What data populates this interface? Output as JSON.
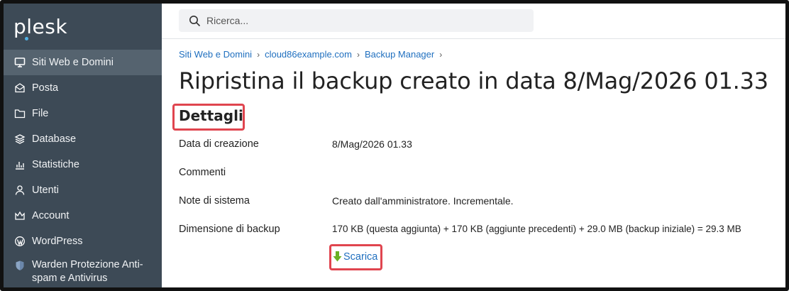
{
  "app": {
    "logo": "plesk"
  },
  "sidebar": {
    "items": [
      {
        "label": "Siti Web e Domini",
        "icon": "monitor-icon",
        "active": true
      },
      {
        "label": "Posta",
        "icon": "mail-icon"
      },
      {
        "label": "File",
        "icon": "folder-icon"
      },
      {
        "label": "Database",
        "icon": "database-icon"
      },
      {
        "label": "Statistiche",
        "icon": "bar-chart-icon"
      },
      {
        "label": "Utenti",
        "icon": "user-icon"
      },
      {
        "label": "Account",
        "icon": "crown-icon"
      },
      {
        "label": "WordPress",
        "icon": "wordpress-icon"
      },
      {
        "label": "Warden Protezione Anti-spam e Antivirus",
        "icon": "shield-icon"
      }
    ]
  },
  "search": {
    "placeholder": "Ricerca..."
  },
  "breadcrumb": {
    "items": [
      "Siti Web e Domini",
      "cloud86example.com",
      "Backup Manager"
    ],
    "separator": "›"
  },
  "page": {
    "title": "Ripristina il backup creato in data 8/Mag/2026 01.33",
    "section_title": "Dettagli"
  },
  "details": [
    {
      "label": "Data di creazione",
      "value": "8/Mag/2026 01.33"
    },
    {
      "label": "Commenti",
      "value": ""
    },
    {
      "label": "Note di sistema",
      "value": "Creato dall'amministratore. Incrementale."
    },
    {
      "label": "Dimensione di backup",
      "value": "170 KB (questa aggiunta) + 170 KB (aggiunte precedenti) + 29.0 MB (backup iniziale) = 29.3 MB"
    }
  ],
  "download": {
    "label": "Scarica",
    "icon": "download-arrow-icon"
  },
  "colors": {
    "sidebar_bg": "#3d4a56",
    "sidebar_active": "#55636f",
    "link": "#1f6fbf",
    "highlight": "#e0454f",
    "download_arrow": "#6ab023"
  }
}
